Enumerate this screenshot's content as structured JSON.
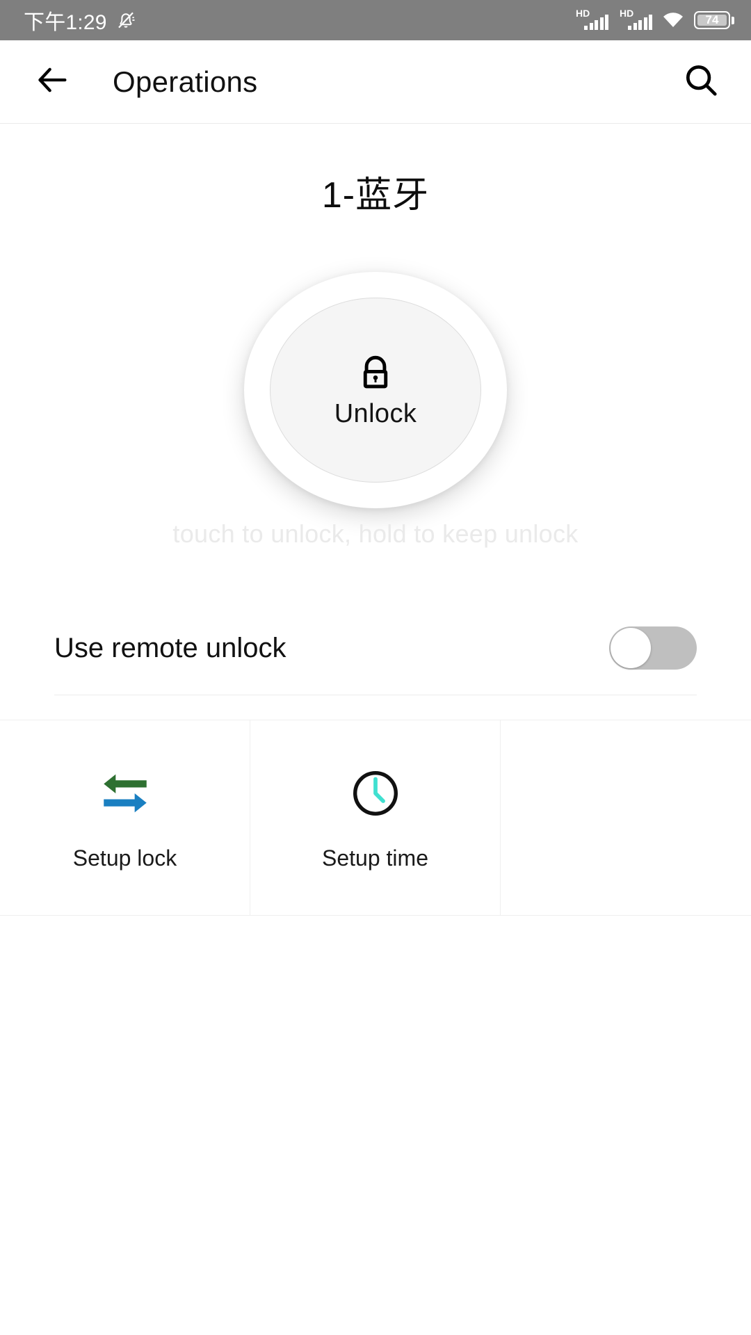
{
  "status_bar": {
    "clock": "下午1:29",
    "mute_icon": "bell-mute-icon",
    "signal_1": {
      "tag": "HD",
      "icon": "signal-bars-icon",
      "bars": 5
    },
    "signal_2": {
      "tag": "HD",
      "icon": "signal-bars-icon",
      "bars": 5
    },
    "wifi_icon": "wifi-icon",
    "battery": {
      "level": "74",
      "icon": "battery-icon"
    }
  },
  "app_bar": {
    "back_icon": "back-arrow-icon",
    "title": "Operations",
    "search_icon": "search-icon"
  },
  "device": {
    "title": "1-蓝牙"
  },
  "unlock_dial": {
    "lock_icon": "padlock-closed-icon",
    "label": "Unlock",
    "hint": "touch to unlock, hold to keep unlock"
  },
  "remote_unlock": {
    "label": "Use remote unlock",
    "state": "off"
  },
  "actions": [
    {
      "icon": "sync-arrows-icon",
      "label": "Setup lock"
    },
    {
      "icon": "clock-icon",
      "label": "Setup time"
    },
    {
      "icon": "",
      "label": ""
    }
  ],
  "colors": {
    "status_bar_bg": "#7f7f7f",
    "arrow_green": "#2e7031",
    "arrow_blue": "#1a7fc1",
    "clock_hands": "#40e0d0",
    "hint_gray": "#eaeaea",
    "switch_track": "#bfbfbf"
  }
}
